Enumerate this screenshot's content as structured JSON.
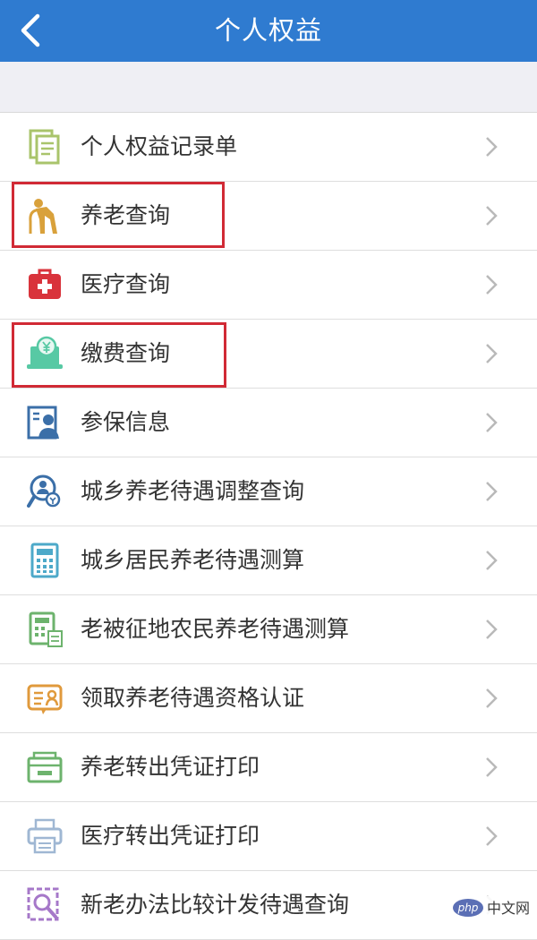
{
  "header": {
    "title": "个人权益",
    "back_icon": "chevron-left-icon",
    "background": "#2f7bd0"
  },
  "items": [
    {
      "label": "个人权益记录单",
      "icon": "document-list-icon"
    },
    {
      "label": "养老查询",
      "icon": "elderly-person-icon",
      "highlighted": true
    },
    {
      "label": "医疗查询",
      "icon": "medical-kit-icon"
    },
    {
      "label": "缴费查询",
      "icon": "yuan-payment-icon",
      "highlighted": true
    },
    {
      "label": "参保信息",
      "icon": "person-card-icon"
    },
    {
      "label": "城乡养老待遇调整查询",
      "icon": "search-person-icon"
    },
    {
      "label": "城乡居民养老待遇测算",
      "icon": "calculator-icon"
    },
    {
      "label": "老被征地农民养老待遇测算",
      "icon": "calculator-table-icon"
    },
    {
      "label": "领取养老待遇资格认证",
      "icon": "id-card-icon"
    },
    {
      "label": "养老转出凭证打印",
      "icon": "card-reader-icon"
    },
    {
      "label": "医疗转出凭证打印",
      "icon": "printer-icon"
    },
    {
      "label": "新老办法比较计发待遇查询",
      "icon": "compare-search-icon"
    }
  ],
  "highlight_color": "#d12a35",
  "watermark": {
    "php": "php",
    "cn": "中文网"
  }
}
